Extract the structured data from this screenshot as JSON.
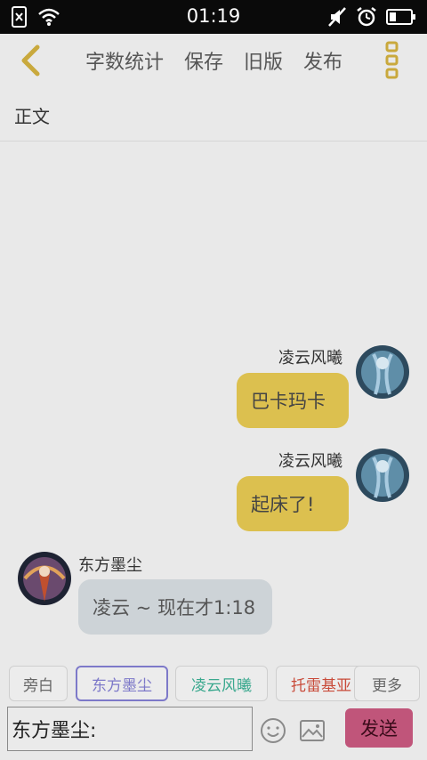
{
  "status_bar": {
    "time": "01:19",
    "left_icons": [
      "sim-card-off-icon",
      "wifi-icon"
    ],
    "right_icons": [
      "mute-icon",
      "alarm-icon",
      "battery-icon"
    ]
  },
  "toolbar": {
    "back_icon": "chevron-left-icon",
    "actions": [
      "字数统计",
      "保存",
      "旧版",
      "发布"
    ],
    "more_icon": "more-vertical-icon",
    "icon_color": "#c9a93d"
  },
  "section": {
    "label": "正文"
  },
  "messages": [
    {
      "side": "right",
      "name": "凌云风曦",
      "text": "巴卡玛卡"
    },
    {
      "side": "right",
      "name": "凌云风曦",
      "text": "起床了!"
    },
    {
      "side": "left",
      "name": "东方墨尘",
      "text": "凌云 ~ 现在才1:18"
    }
  ],
  "roles": [
    {
      "label": "旁白",
      "color": "#666666",
      "active": false
    },
    {
      "label": "东方墨尘",
      "color": "#7d79c9",
      "active": true
    },
    {
      "label": "凌云风曦",
      "color": "#3aa88e",
      "active": false
    },
    {
      "label": "托雷基亚",
      "color": "#c94b3a",
      "active": false
    },
    {
      "label": "更多",
      "color": "#666666",
      "active": false
    }
  ],
  "input": {
    "value": "东方墨尘:",
    "emoji_icon": "smiley-icon",
    "image_icon": "image-icon",
    "send_label": "发送"
  },
  "colors": {
    "bubble_right": "#dcc04f",
    "bubble_left": "#cdd3d7",
    "send_button": "#c0557a"
  }
}
